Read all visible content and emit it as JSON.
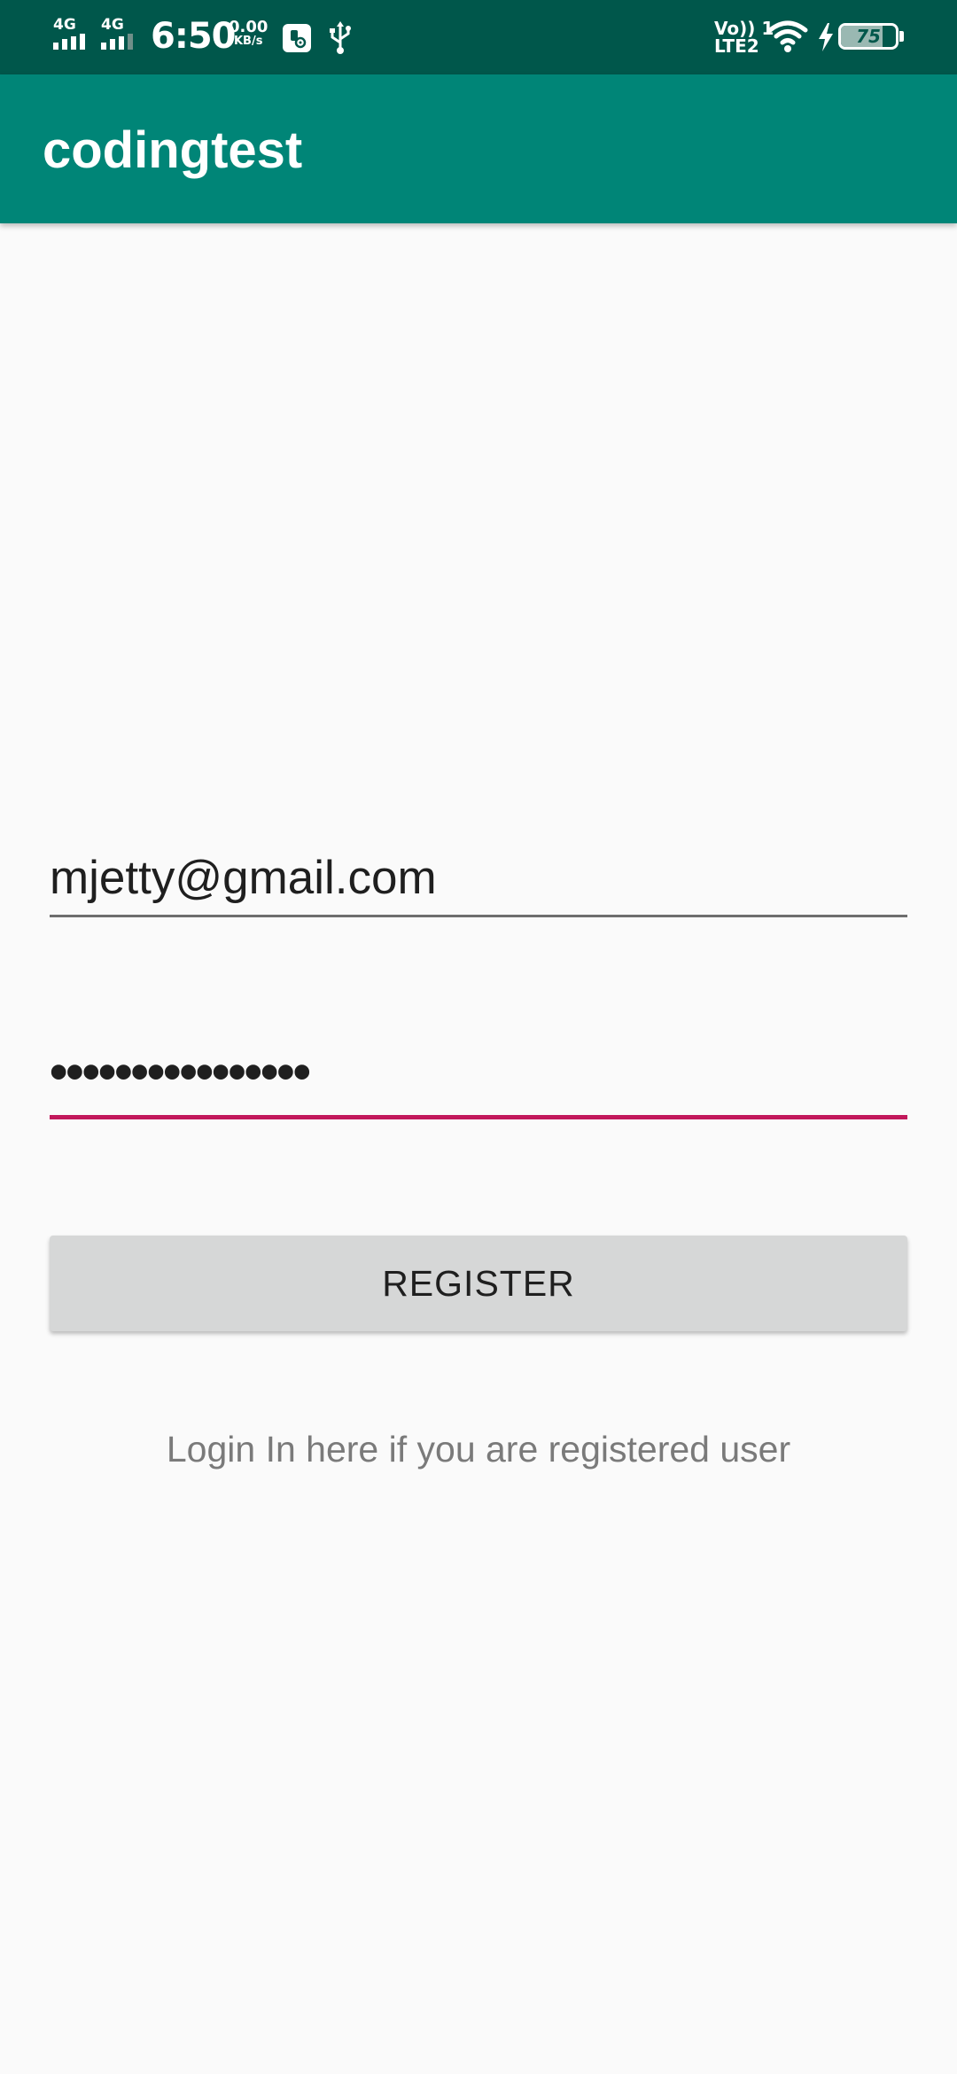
{
  "status_bar": {
    "network_1": "4G",
    "network_2": "4G",
    "time": "6:50",
    "data_speed_value": "0.00",
    "data_speed_unit": "KB/s",
    "volte_label": "Vo)) 1",
    "lte_label": "LTE2",
    "battery_level": "75",
    "icons": [
      "signal-icon",
      "signal-icon",
      "usb-debug-icon",
      "usb-icon",
      "wifi-icon",
      "charging-icon",
      "battery-icon"
    ],
    "background_color": "#00574b"
  },
  "app_bar": {
    "title": "codingtest",
    "background_color": "#008577"
  },
  "form": {
    "email_value": "mjetty@gmail.com",
    "password_value": "••••••••••••••••",
    "register_label": "REGISTER",
    "login_link_label": "Login In here if you are registered user",
    "accent_color": "#c2185b"
  }
}
